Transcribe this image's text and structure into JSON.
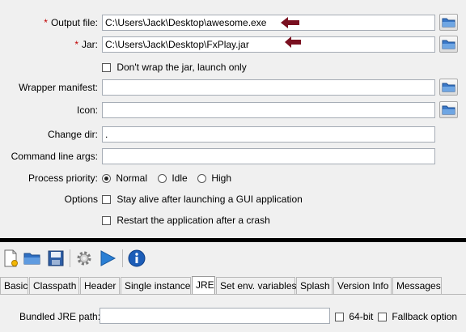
{
  "form": {
    "output_file": {
      "label": "Output file:",
      "required": "*",
      "value": "C:\\Users\\Jack\\Desktop\\awesome.exe"
    },
    "jar": {
      "label": "Jar:",
      "required": "*",
      "value": "C:\\Users\\Jack\\Desktop\\FxPlay.jar"
    },
    "dont_wrap": {
      "label": "Don't wrap the jar, launch only",
      "checked": false
    },
    "wrapper_manifest": {
      "label": "Wrapper manifest:",
      "value": ""
    },
    "icon": {
      "label": "Icon:",
      "value": ""
    },
    "change_dir": {
      "label": "Change dir:",
      "value": "."
    },
    "cmd_args": {
      "label": "Command line args:",
      "value": ""
    },
    "priority": {
      "label": "Process priority:",
      "options": [
        "Normal",
        "Idle",
        "High"
      ],
      "selected": "Normal"
    },
    "options": {
      "label": "Options",
      "stay_alive": "Stay alive after launching a GUI application",
      "restart": "Restart the application after a crash"
    }
  },
  "annotations": {
    "arrow_color": "#7a1020"
  },
  "toolbar": {
    "icons": [
      "new-config-icon",
      "open-folder-icon",
      "save-icon",
      "settings-gear-icon",
      "run-play-icon",
      "info-icon"
    ]
  },
  "tabs": [
    "Basic",
    "Classpath",
    "Header",
    "Single instance",
    "JRE",
    "Set env. variables",
    "Splash",
    "Version Info",
    "Messages"
  ],
  "active_tab": "JRE",
  "jre": {
    "bundled_label": "Bundled JRE path:",
    "bundled_value": "",
    "bit64": "64-bit",
    "fallback": "Fallback option"
  }
}
